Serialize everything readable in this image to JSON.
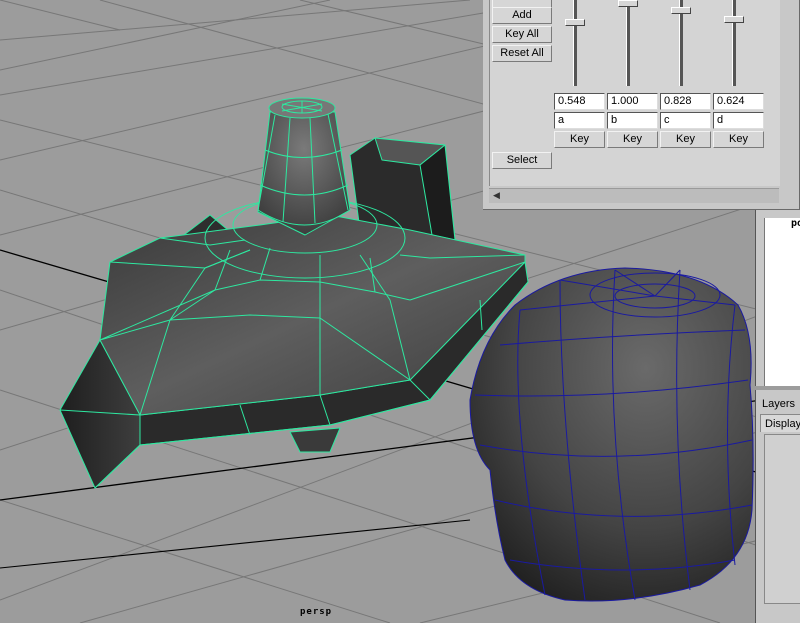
{
  "blend_shape": {
    "buttons": {
      "add": "Add",
      "key_all": "Key All",
      "reset_all": "Reset All",
      "select": "Select"
    },
    "targets": [
      {
        "value": "0.548",
        "name": "a",
        "key_label": "Key",
        "level": 0.548
      },
      {
        "value": "1.000",
        "name": "b",
        "key_label": "Key",
        "level": 1.0
      },
      {
        "value": "0.828",
        "name": "c",
        "key_label": "Key",
        "level": 0.828
      },
      {
        "value": "0.624",
        "name": "d",
        "key_label": "Key",
        "level": 0.624
      }
    ]
  },
  "side_panel": {
    "upper_text": "poly",
    "layers_label": "Layers",
    "display_tab": "Display"
  },
  "viewport": {
    "camera_label": "persp"
  },
  "colors": {
    "selected_wire": "#2ee8a0",
    "unselected_wire": "#1a1aa0",
    "grid": "#6e6e6e",
    "viewport_bg": "#9a9a9a"
  }
}
